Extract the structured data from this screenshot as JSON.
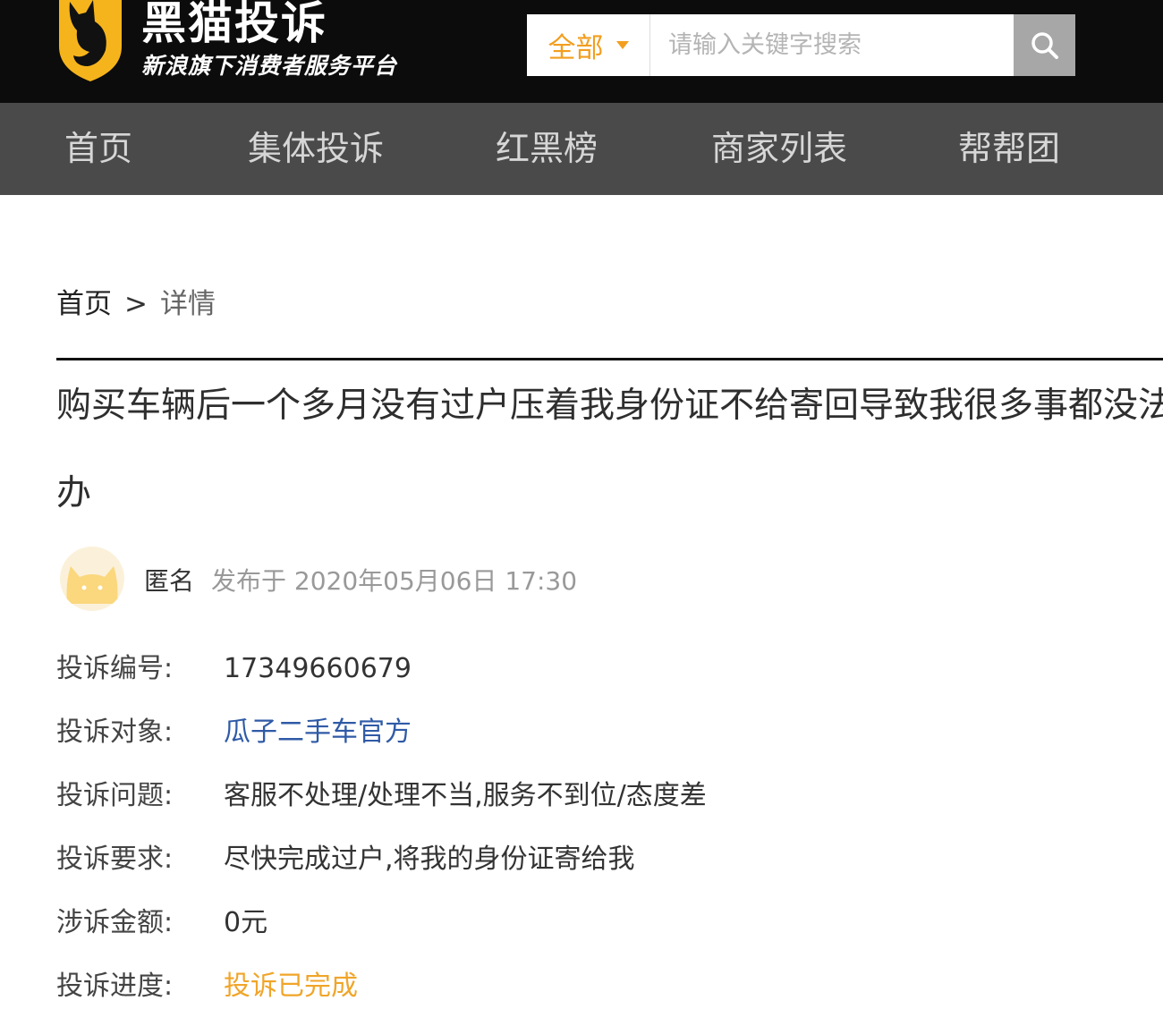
{
  "header": {
    "logo_title": "黑猫投诉",
    "logo_subtitle": "新浪旗下消费者服务平台",
    "search": {
      "scope_label": "全部",
      "placeholder": "请输入关键字搜索",
      "value": ""
    }
  },
  "nav": {
    "items": [
      {
        "label": "首页"
      },
      {
        "label": "集体投诉"
      },
      {
        "label": "红黑榜"
      },
      {
        "label": "商家列表"
      },
      {
        "label": "帮帮团"
      }
    ]
  },
  "breadcrumb": {
    "home": "首页",
    "separator": ">",
    "current": "详情"
  },
  "complaint": {
    "title_line1": "购买车辆后一个多月没有过户压着我身份证不给寄回导致我很多事都没法",
    "title_line2": "办",
    "author": "匿名",
    "publish_time": "发布于 2020年05月06日 17:30",
    "fields": [
      {
        "label": "投诉编号:",
        "value": "17349660679"
      },
      {
        "label": "投诉对象:",
        "value": "瓜子二手车官方"
      },
      {
        "label": "投诉问题:",
        "value": "客服不处理/处理不当,服务不到位/态度差"
      },
      {
        "label": "投诉要求:",
        "value": "尽快完成过户,将我的身份证寄给我"
      },
      {
        "label": "涉诉金额:",
        "value": "0元"
      },
      {
        "label": "投诉进度:",
        "value": "投诉已完成"
      }
    ]
  },
  "colors": {
    "topbar": "#0c0c0c",
    "navbar": "#4a4a4a",
    "accent_orange": "#f29e1f",
    "link_blue": "#2f5aa6",
    "status_orange": "#f0a52a"
  },
  "icons": {
    "logo": "black-cat-shield-icon",
    "search": "search-icon",
    "dropdown": "caret-down-icon",
    "avatar": "cat-avatar-icon"
  }
}
